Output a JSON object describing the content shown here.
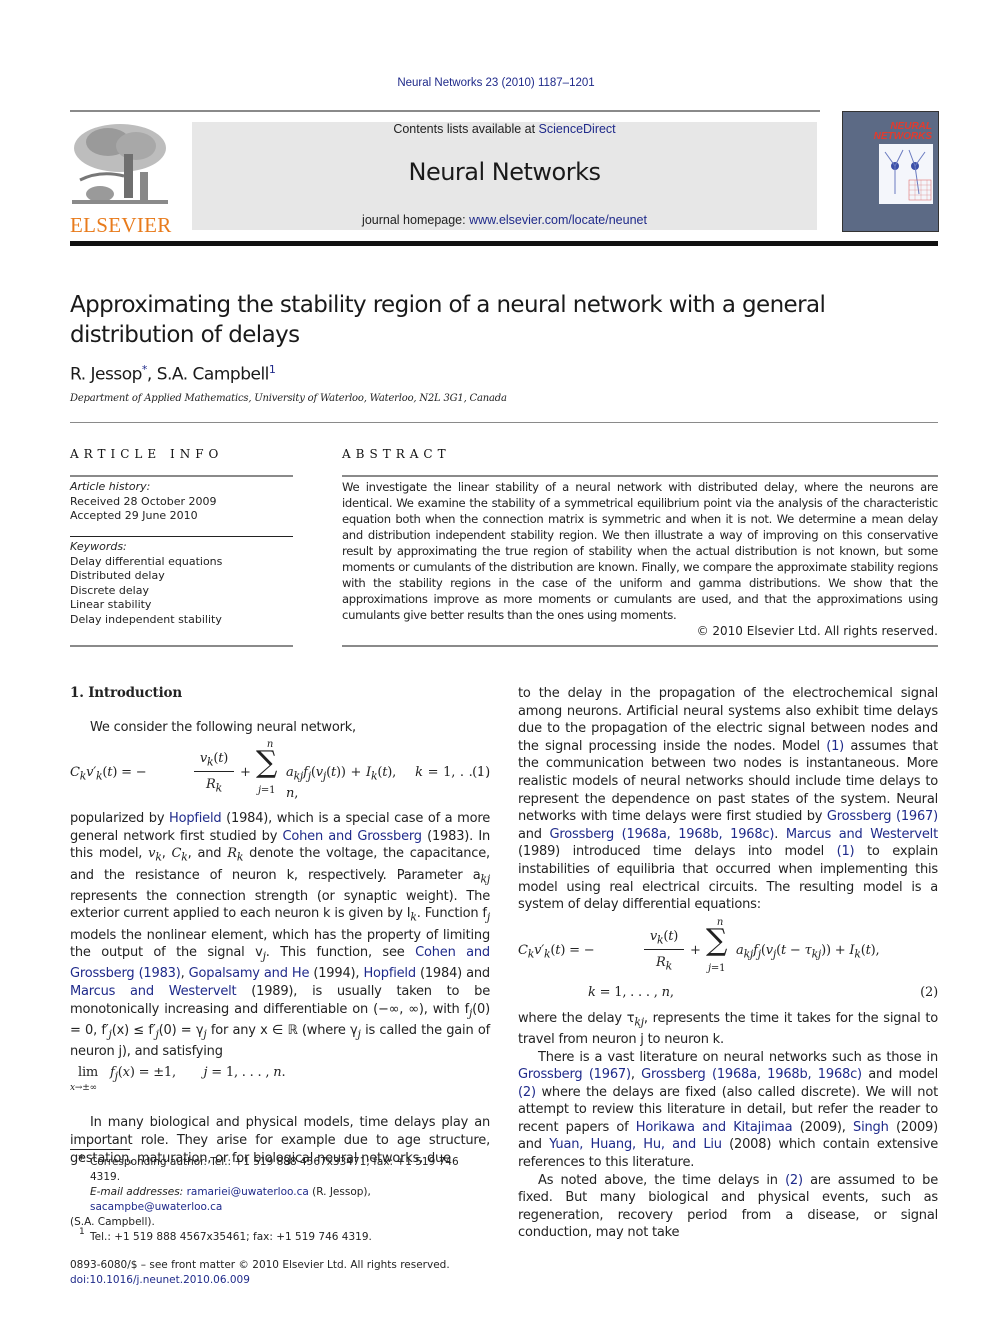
{
  "header": {
    "running_head": "Neural Networks 23 (2010) 1187–1201",
    "publisher_logo_text": "ELSEVIER",
    "contents_prefix": "Contents lists available at ",
    "contents_link": "ScienceDirect",
    "journal_name": "Neural Networks",
    "homepage_prefix": "journal homepage: ",
    "homepage_link": "www.elsevier.com/locate/neunet",
    "cover_title": "NEURAL NETWORKS",
    "colors": {
      "link": "#1f2a8a",
      "elsevier_orange": "#e87b1c",
      "banner_bg": "#e7e7e7"
    }
  },
  "article": {
    "title": "Approximating the stability region of a neural network with a general distribution of delays",
    "authors": [
      {
        "name": "R. Jessop",
        "mark": "*"
      },
      {
        "name": "S.A. Campbell",
        "mark": "1"
      }
    ],
    "author_separator": ", ",
    "affiliation": "Department of Applied Mathematics, University of Waterloo, Waterloo, N2L 3G1, Canada"
  },
  "article_info": {
    "heading": "ARTICLE INFO",
    "history_label": "Article history:",
    "received": "Received 28 October 2009",
    "accepted": "Accepted 29 June 2010",
    "keywords_label": "Keywords:",
    "keywords": [
      "Delay differential equations",
      "Distributed delay",
      "Discrete delay",
      "Linear stability",
      "Delay independent stability"
    ]
  },
  "abstract": {
    "heading": "ABSTRACT",
    "text": "We investigate the linear stability of a neural network with distributed delay, where the neurons are identical. We examine the stability of a symmetrical equilibrium point via the analysis of the characteristic equation both when the connection matrix is symmetric and when it is not. We determine a mean delay and distribution independent stability region. We then illustrate a way of improving on this conservative result by approximating the true region of stability when the actual distribution is not known, but some moments or cumulants of the distribution are known. Finally, we compare the approximate stability regions with the stability regions in the case of the uniform and gamma distributions. We show that the approximations improve as more moments or cumulants are used, and that the approximations using cumulants give better results than the ones using moments.",
    "copyright": "© 2010 Elsevier Ltd. All rights reserved."
  },
  "body": {
    "section_title": "1.  Introduction",
    "intro_sentence": "We consider the following neural network,",
    "eq1_number": "(1)",
    "eq2_number": "(2)",
    "left_p1": {
      "t1": "popularized by ",
      "l1": "Hopfield",
      "t2": " (1984), which is a special case of a more general network first studied by ",
      "l2": "Cohen and Grossberg",
      "t3": " (1983). In this model, ",
      "t4": " denote the voltage, the capacitance, and the resistance of neuron k, respectively. Parameter a",
      "t5": " represents the connection strength (or synaptic weight). The exterior current applied to each neuron k is given by I",
      "t6": ". Function f",
      "t7": " models the nonlinear element, which has the property of limiting the output of the signal v",
      "t8": ". This function, see ",
      "l3": "Cohen and Grossberg (1983)",
      "s1": ", ",
      "l4": "Gopalsamy and He",
      "t9": " (1994), ",
      "l5": "Hopfield",
      "t10": " (1984) and ",
      "l6": "Marcus and Westervelt",
      "t11": " (1989), is usually taken to be monotonically increasing and differentiable on (−∞, ∞), with f",
      "t12": "(0) = 0, f′",
      "t13": "(x) ≤ f′",
      "t14": "(0) = γ",
      "t15": " for any x ∈ ℝ (where γ",
      "t16": " is called the gain of neuron j), and satisfying"
    },
    "limit_eq": "lim f_j(x) = ±1,   j = 1, . . . , n.",
    "left_p2": "In many biological and physical models, time delays play an important role. They arise for example due to age structure, gestation, maturation, or for biological neural networks, due",
    "right_p1": {
      "t1": "to the delay in the propagation of the electrochemical signal among neurons. Artificial neural systems also exhibit time delays due to the propagation of the electric signal between nodes and the signal processing inside the nodes. Model ",
      "l1": "(1)",
      "t2": " assumes that the communication between two nodes is instantaneous. More realistic models of neural networks should include time delays to represent the dependence on past states of the system. Neural networks with time delays were first studied by ",
      "l2": "Grossberg (1967)",
      "t3": " and ",
      "l3": "Grossberg (1968a, 1968b, 1968c)",
      "t4": ". ",
      "l4": "Marcus and Westervelt",
      "t5": " (1989) introduced time delays into model ",
      "l5": "(1)",
      "t6": " to explain instabilities of equilibria that occurred when implementing this model using real electrical circuits. The resulting model is a system of delay differential equations:"
    },
    "right_p2": {
      "t1": "where the delay τ",
      "t2": ", represents the time it takes for the signal to travel from neuron j to neuron k."
    },
    "right_p3": {
      "t1": "There is a vast literature on neural networks such as those in ",
      "l1": "Grossberg (1967)",
      "s1": ", ",
      "l2": "Grossberg (1968a, 1968b, 1968c)",
      "t2": " and model ",
      "l3": "(2)",
      "t3": " where the delays are fixed (also called discrete). We will not attempt to review this literature in detail, but refer the reader to recent papers of ",
      "l4": "Horikawa and Kitajimaa",
      "t4": " (2009), ",
      "l5": "Singh",
      "t5": " (2009) and ",
      "l6": "Yuan, Huang, Hu, and Liu",
      "t6": " (2008) which contain extensive references to this literature."
    },
    "right_p4": {
      "t1": "As noted above, the time delays in ",
      "l1": "(2)",
      "t2": " are assumed to be fixed. But many biological and physical events, such as regeneration, recovery period from a disease, or signal conduction, may not take"
    }
  },
  "footnotes": {
    "star_mark": "*",
    "star_text": "Corresponding author. Tel.: +1 519 888 4567x33471; fax: +1 519 746 4319.",
    "email_label": "E-mail addresses:",
    "email1": "ramariei@uwaterloo.ca",
    "email1_owner": " (R. Jessop), ",
    "email2": "sacampbe@uwaterloo.ca",
    "email2_owner": "(S.A. Campbell).",
    "one_mark": "1",
    "one_text": "Tel.: +1 519 888 4567x35461; fax: +1 519 746 4319.",
    "front_matter": "0893-6080/$ – see front matter © 2010 Elsevier Ltd. All rights reserved.",
    "doi": "doi:10.1016/j.neunet.2010.06.009"
  }
}
